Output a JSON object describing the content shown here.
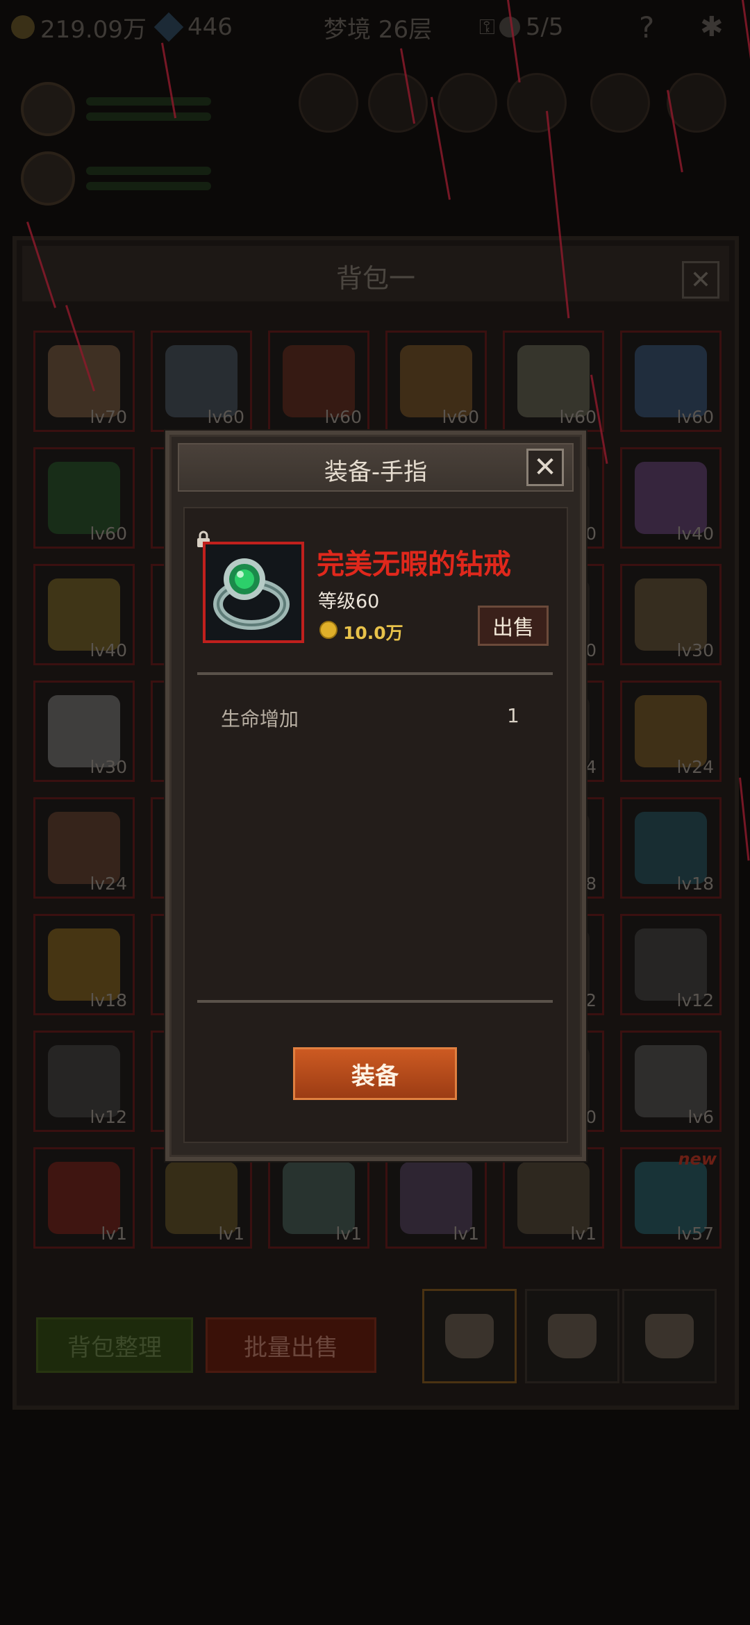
{
  "topbar": {
    "gold": "219.09万",
    "gems": "446",
    "dungeon": "梦境 26层",
    "lives": "5/5",
    "help": "?"
  },
  "bag": {
    "title": "背包一",
    "close": "✕",
    "arrange_label": "背包整理",
    "batch_sell_label": "批量出售",
    "items": [
      {
        "lv": "lv70",
        "color": "#6b5038"
      },
      {
        "lv": "lv60",
        "color": "#3e4a55"
      },
      {
        "lv": "lv60",
        "color": "#5a2418"
      },
      {
        "lv": "lv60",
        "color": "#6b4a20"
      },
      {
        "lv": "lv60",
        "color": "#5a5a4a"
      },
      {
        "lv": "lv60",
        "color": "#2e4a6b"
      },
      {
        "lv": "lv60",
        "color": "#1e4a22"
      },
      {
        "lv": "",
        "color": "#3e4a55"
      },
      {
        "lv": "",
        "color": "#2a2420"
      },
      {
        "lv": "",
        "color": "#2a2420"
      },
      {
        "lv": "0",
        "color": "#2a2420"
      },
      {
        "lv": "lv40",
        "color": "#5a3a6b"
      },
      {
        "lv": "lv40",
        "color": "#6b5a20"
      },
      {
        "lv": "",
        "color": "#3a3530"
      },
      {
        "lv": "",
        "color": "#2a2420"
      },
      {
        "lv": "",
        "color": "#2a2420"
      },
      {
        "lv": "0",
        "color": "#2a2420"
      },
      {
        "lv": "lv30",
        "color": "#5a4a30"
      },
      {
        "lv": "lv30",
        "color": "#6b6b6b"
      },
      {
        "lv": "",
        "color": "#3a3530"
      },
      {
        "lv": "",
        "color": "#2a2420"
      },
      {
        "lv": "",
        "color": "#2a2420"
      },
      {
        "lv": "4",
        "color": "#2a2420"
      },
      {
        "lv": "lv24",
        "color": "#6b5020"
      },
      {
        "lv": "lv24",
        "color": "#5a3828"
      },
      {
        "lv": "",
        "color": "#3a3530"
      },
      {
        "lv": "",
        "color": "#2a2420"
      },
      {
        "lv": "",
        "color": "#2a2420"
      },
      {
        "lv": "8",
        "color": "#2a2420"
      },
      {
        "lv": "lv18",
        "color": "#1e4a55"
      },
      {
        "lv": "lv18",
        "color": "#7a5a18"
      },
      {
        "lv": "",
        "color": "#3a3530"
      },
      {
        "lv": "",
        "color": "#2a2420"
      },
      {
        "lv": "",
        "color": "#2a2420"
      },
      {
        "lv": "2",
        "color": "#2a2420"
      },
      {
        "lv": "lv12",
        "color": "#3a3a3a"
      },
      {
        "lv": "lv12",
        "color": "#3a3a3a"
      },
      {
        "lv": "",
        "color": "#3a3530"
      },
      {
        "lv": "",
        "color": "#2a2420"
      },
      {
        "lv": "",
        "color": "#2a2420"
      },
      {
        "lv": "0",
        "color": "#2a2420"
      },
      {
        "lv": "lv6",
        "color": "#4a4a4a"
      },
      {
        "lv": "lv1",
        "color": "#6b1a14"
      },
      {
        "lv": "lv1",
        "color": "#5a4a20"
      },
      {
        "lv": "lv1",
        "color": "#3e5550"
      },
      {
        "lv": "lv1",
        "color": "#4a3a55"
      },
      {
        "lv": "lv1",
        "color": "#4a4030"
      },
      {
        "lv": "lv57",
        "color": "#1e5560"
      }
    ],
    "new_badge": "new"
  },
  "dialog": {
    "title": "装备-手指",
    "close": "✕",
    "item_name": "完美无暇的钻戒",
    "level": "等级60",
    "price": "10.0万",
    "sell_label": "出售",
    "stats": [
      {
        "name": "生命增加",
        "value": "1"
      }
    ],
    "equip_label": "装备",
    "name_color": "#e0281c"
  }
}
